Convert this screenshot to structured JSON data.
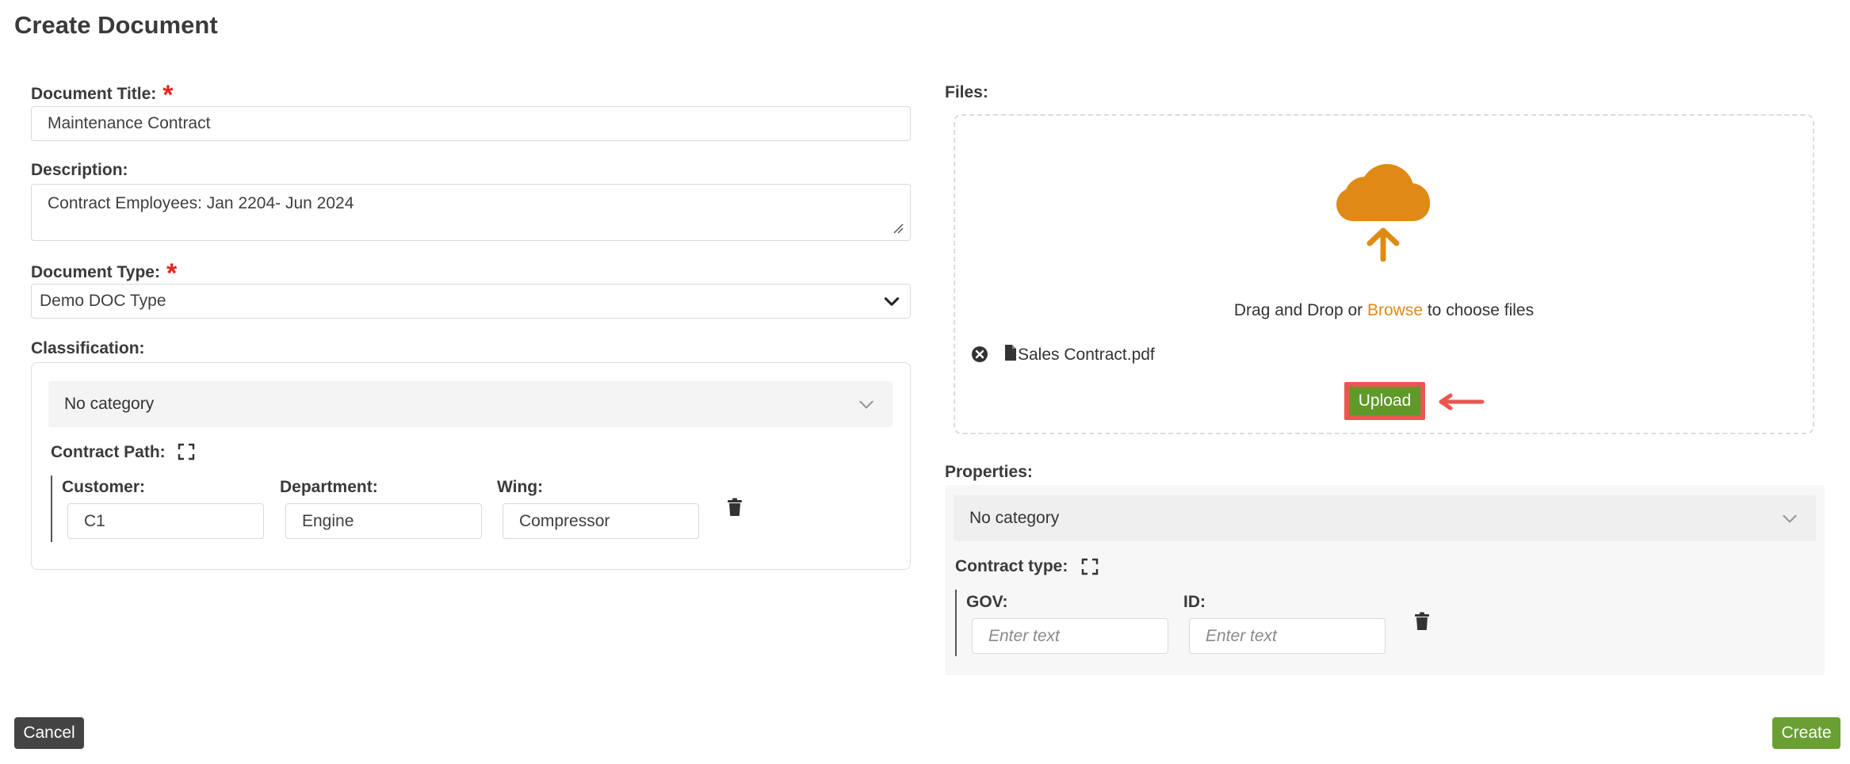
{
  "page": {
    "title": "Create Document"
  },
  "left": {
    "document_title": {
      "label": "Document Title:",
      "value": "Maintenance Contract"
    },
    "description": {
      "label": "Description:",
      "value": "Contract Employees: Jan 2204- Jun 2024"
    },
    "document_type": {
      "label": "Document Type:",
      "value": "Demo DOC Type"
    },
    "classification": {
      "label": "Classification:",
      "category": "No category",
      "path_label": "Contract Path:",
      "fields": [
        {
          "label": "Customer:",
          "value": "C1"
        },
        {
          "label": "Department:",
          "value": "Engine"
        },
        {
          "label": "Wing:",
          "value": "Compressor"
        }
      ]
    }
  },
  "right": {
    "files": {
      "label": "Files:",
      "drop_text_before": "Drag and Drop or ",
      "browse": "Browse",
      "drop_text_after": " to choose files",
      "file_name": "Sales Contract.pdf",
      "upload_label": "Upload"
    },
    "properties": {
      "label": "Properties:",
      "category": "No category",
      "type_label": "Contract type:",
      "fields": [
        {
          "label": "GOV:",
          "placeholder": "Enter text"
        },
        {
          "label": "ID:",
          "placeholder": "Enter text"
        }
      ]
    }
  },
  "footer": {
    "cancel_label": "Cancel",
    "create_label": "Create"
  },
  "colors": {
    "accent_orange": "#e08a16",
    "create_green": "#6aa033",
    "upload_green": "#5d9a27",
    "required_red": "#e8221c",
    "highlight_red": "#e9574f"
  }
}
